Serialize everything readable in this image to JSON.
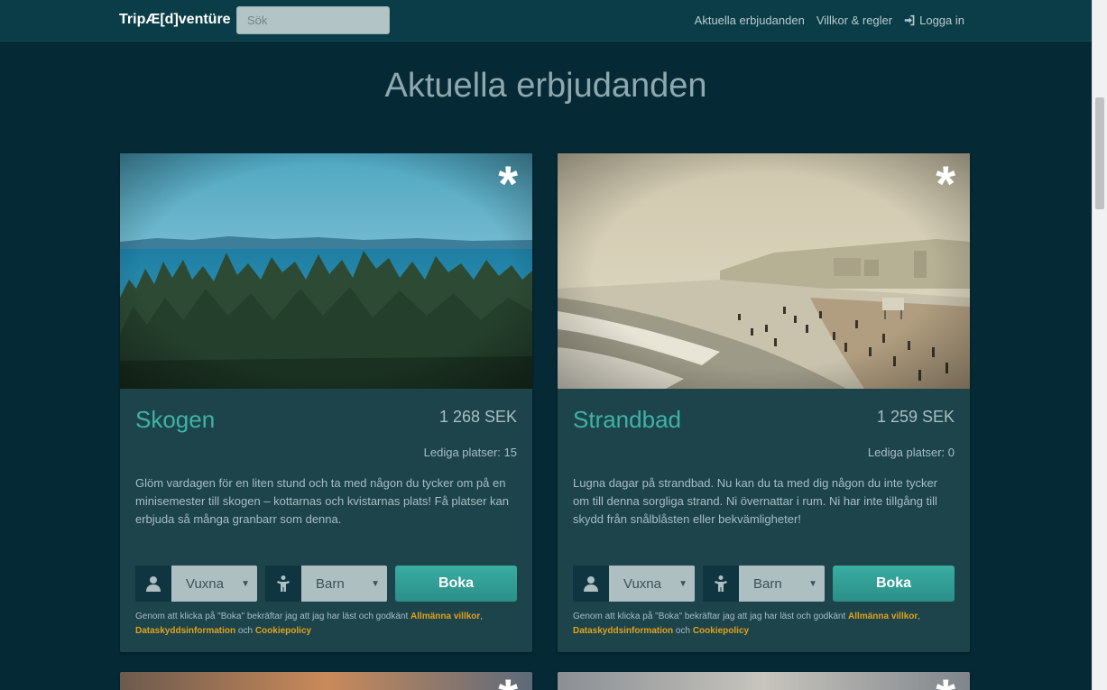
{
  "navbar": {
    "brand": "TripÆ[d]ventüre",
    "search_placeholder": "Sök",
    "links": [
      "Aktuella erbjudanden",
      "Villkor & regler"
    ],
    "login": "Logga in"
  },
  "page": {
    "title": "Aktuella erbjudanden"
  },
  "offers": [
    {
      "star": "*",
      "title": "Skogen",
      "price": "1 268 SEK",
      "seats": "Lediga platser: 15",
      "description": "Glöm vardagen för en liten stund och ta med någon du tycker om på en minisemester till skogen – kottarnas och kvistarnas plats! Få platser kan erbjuda så många granbarr som denna.",
      "adults_select": "Vuxna",
      "children_select": "Barn",
      "book_label": "Boka",
      "image_icon": "forest-lake-image"
    },
    {
      "star": "*",
      "title": "Strandbad",
      "price": "1 259 SEK",
      "seats": "Lediga platser: 0",
      "description": "Lugna dagar på strandbad. Nu kan du ta med dig någon du inte tycker om till denna sorgliga strand. Ni övernattar i rum. Ni har inte tillgång till skydd från snålblåsten eller bekvämligheter!",
      "adults_select": "Vuxna",
      "children_select": "Barn",
      "book_label": "Boka",
      "image_icon": "beach-image"
    }
  ],
  "legal": {
    "prefix": "Genom att klicka på \"Boka\" bekräftar jag att jag har läst och godkänt",
    "terms": "Allmänna villkor",
    "comma": ",",
    "privacy": "Dataskyddsinformation",
    "and": "och",
    "cookie": "Cookiepolicy"
  },
  "colors": {
    "background": "#052a35",
    "navbar": "#0a3d47",
    "card": "#1d434b",
    "accent": "#3fb3a6",
    "link": "#e0a31a"
  }
}
